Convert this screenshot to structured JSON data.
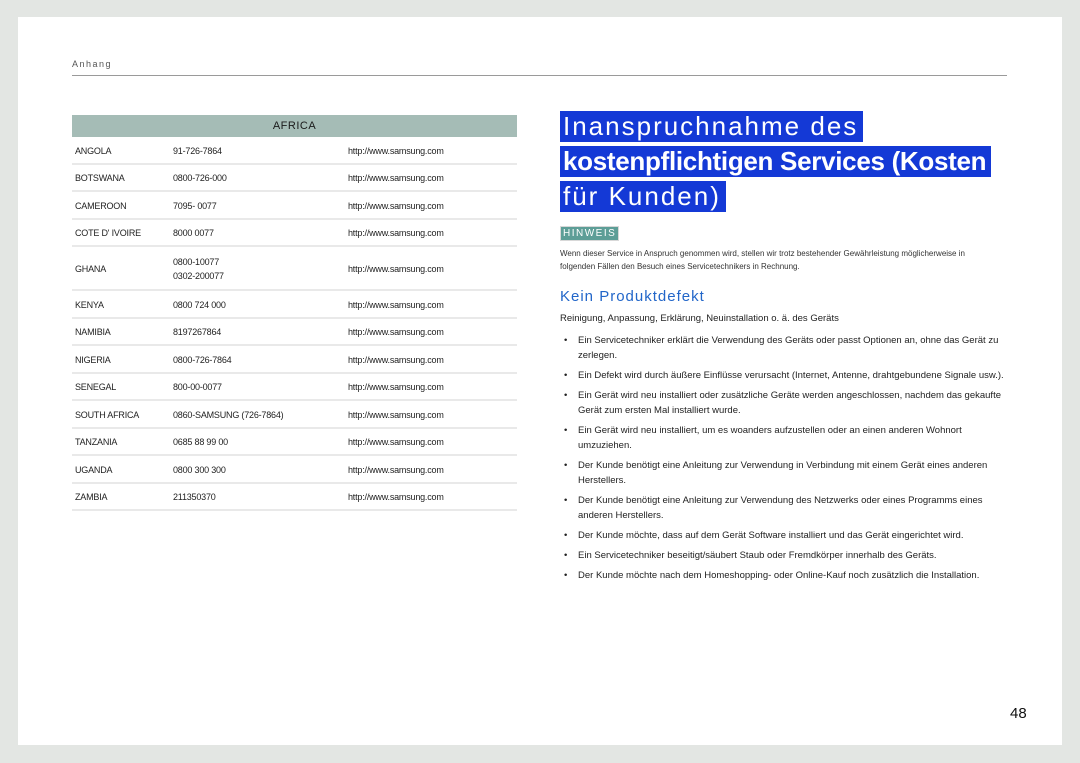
{
  "header": {
    "section": "Anhang"
  },
  "contacts": {
    "region": "AFRICA",
    "rows": [
      {
        "country": "ANGOLA",
        "phones": [
          "91-726-7864"
        ],
        "url": "http://www.samsung.com"
      },
      {
        "country": "BOTSWANA",
        "phones": [
          "0800-726-000"
        ],
        "url": "http://www.samsung.com"
      },
      {
        "country": "CAMEROON",
        "phones": [
          "7095- 0077"
        ],
        "url": "http://www.samsung.com"
      },
      {
        "country": "COTE D' IVOIRE",
        "phones": [
          "8000 0077"
        ],
        "url": "http://www.samsung.com"
      },
      {
        "country": "GHANA",
        "phones": [
          "0800-10077",
          "0302-200077"
        ],
        "url": "http://www.samsung.com"
      },
      {
        "country": "KENYA",
        "phones": [
          "0800 724 000"
        ],
        "url": "http://www.samsung.com"
      },
      {
        "country": "NAMIBIA",
        "phones": [
          "8197267864"
        ],
        "url": "http://www.samsung.com"
      },
      {
        "country": "NIGERIA",
        "phones": [
          "0800-726-7864"
        ],
        "url": "http://www.samsung.com"
      },
      {
        "country": "SENEGAL",
        "phones": [
          "800-00-0077"
        ],
        "url": "http://www.samsung.com"
      },
      {
        "country": "SOUTH AFRICA",
        "phones": [
          "0860-SAMSUNG (726-7864)"
        ],
        "url": "http://www.samsung.com"
      },
      {
        "country": "TANZANIA",
        "phones": [
          "0685 88 99 00"
        ],
        "url": "http://www.samsung.com"
      },
      {
        "country": "UGANDA",
        "phones": [
          "0800 300 300"
        ],
        "url": "http://www.samsung.com"
      },
      {
        "country": "ZAMBIA",
        "phones": [
          "211350370"
        ],
        "url": "http://www.samsung.com"
      }
    ]
  },
  "title": {
    "line1": "Inanspruchnahme des",
    "line2": "kostenpflichtigen Services (Kosten",
    "line3": "für Kunden)"
  },
  "note": {
    "badge": "HINWEIS",
    "text": "Wenn dieser Service in Anspruch genommen wird, stellen wir trotz bestehender Gewährleistung möglicherweise in folgenden Fällen den Besuch eines Servicetechnikers in Rechnung."
  },
  "section": {
    "title": "Kein Produktdefekt",
    "intro": "Reinigung, Anpassung, Erklärung, Neuinstallation o. ä. des Geräts",
    "bullets": [
      "Ein Servicetechniker erklärt die Verwendung des Geräts oder passt Optionen an, ohne das Gerät zu zerlegen.",
      "Ein Defekt wird durch äußere Einflüsse verursacht (Internet, Antenne, drahtgebundene Signale usw.).",
      "Ein Gerät wird neu installiert oder zusätzliche Geräte werden angeschlossen, nachdem das gekaufte Gerät zum ersten Mal installiert wurde.",
      "Ein Gerät wird neu installiert, um es woanders aufzustellen oder an einen anderen Wohnort umzuziehen.",
      "Der Kunde benötigt eine Anleitung zur Verwendung in Verbindung mit einem Gerät eines anderen Herstellers.",
      "Der Kunde benötigt eine Anleitung zur Verwendung des Netzwerks oder eines Programms eines anderen Herstellers.",
      "Der Kunde möchte, dass auf dem Gerät Software installiert und das Gerät eingerichtet wird.",
      "Ein Servicetechniker beseitigt/säubert Staub oder Fremdkörper innerhalb des Geräts.",
      "Der Kunde möchte nach dem Homeshopping- oder Online-Kauf noch zusätzlich die Installation."
    ],
    "bullet_glyph": "•"
  },
  "page_number": "48"
}
